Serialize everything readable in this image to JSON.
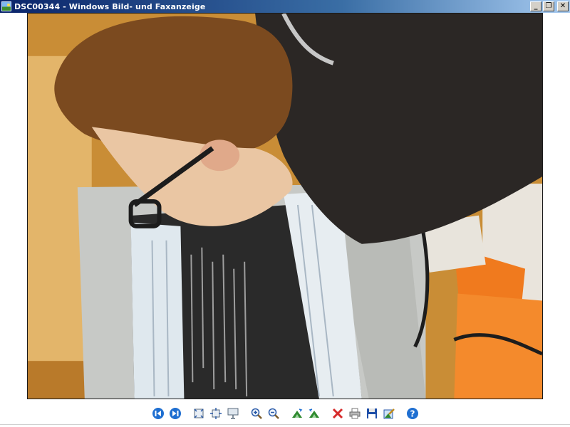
{
  "window": {
    "title": "DSC00344 - Windows Bild- und Faxanzeige",
    "app_icon": "picture-viewer-icon",
    "caption_buttons": {
      "minimize": "_",
      "restore": "❐",
      "close": "✕"
    }
  },
  "image": {
    "description_icon": "photo-content",
    "file_name": "DSC00344"
  },
  "toolbar": {
    "buttons": [
      {
        "name": "previous-image-button",
        "icon": "previous-icon",
        "color": "#1f6fd1"
      },
      {
        "name": "next-image-button",
        "icon": "next-icon",
        "color": "#1f6fd1"
      },
      {
        "name": "best-fit-button",
        "icon": "best-fit-icon"
      },
      {
        "name": "actual-size-button",
        "icon": "actual-size-icon"
      },
      {
        "name": "slideshow-button",
        "icon": "slideshow-icon"
      },
      {
        "name": "zoom-in-button",
        "icon": "zoom-in-icon"
      },
      {
        "name": "zoom-out-button",
        "icon": "zoom-out-icon"
      },
      {
        "name": "rotate-clockwise-button",
        "icon": "rotate-clockwise-icon",
        "color": "#2f8a2f"
      },
      {
        "name": "rotate-counterclockwise-button",
        "icon": "rotate-counterclockwise-icon",
        "color": "#2f8a2f"
      },
      {
        "name": "delete-button",
        "icon": "delete-icon",
        "color": "#d62b2b"
      },
      {
        "name": "print-button",
        "icon": "print-icon"
      },
      {
        "name": "save-button",
        "icon": "save-icon",
        "color": "#1f4fa8"
      },
      {
        "name": "edit-button",
        "icon": "edit-icon"
      },
      {
        "name": "help-button",
        "icon": "help-icon",
        "color": "#1f6fd1"
      }
    ]
  }
}
